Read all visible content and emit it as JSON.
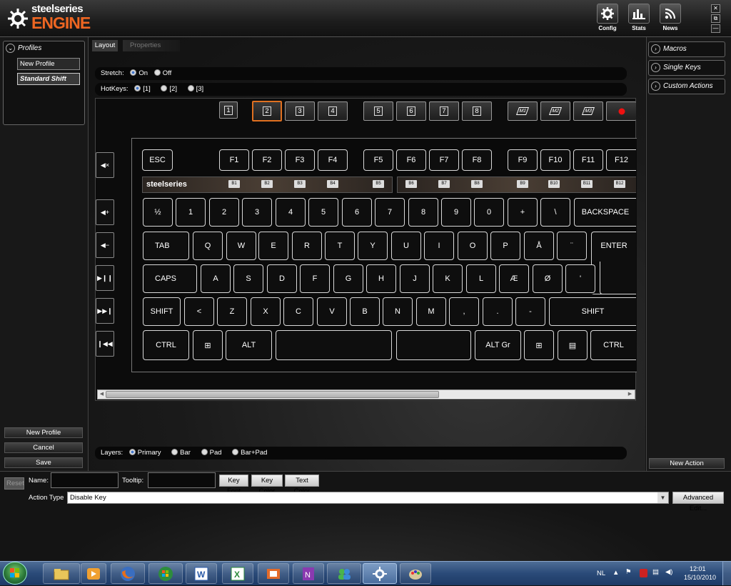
{
  "app": {
    "brand_top": "steelseries",
    "brand_bottom": "ENGINE"
  },
  "topbar": {
    "config": "Config",
    "stats": "Stats",
    "news": "News",
    "close_glyph": "✕",
    "restore_glyph": "⧉",
    "minimize_glyph": "—"
  },
  "tabs": {
    "layout": "Layout",
    "properties": "Properties"
  },
  "profiles": {
    "header": "Profiles",
    "items": [
      "New Profile",
      "Standard Shift"
    ],
    "new_btn": "New Profile",
    "cancel_btn": "Cancel",
    "save_btn": "Save"
  },
  "options": {
    "stretch_label": "Stretch:",
    "stretch_on": "On",
    "stretch_off": "Off",
    "stretch_selected": "On",
    "hotkeys_label": "HotKeys:",
    "hotkeys_opts": [
      "[1]",
      "[2]",
      "[3]"
    ],
    "hotkeys_selected": "[1]"
  },
  "hotkey_buttons": [
    "1",
    "2",
    "3",
    "4",
    "5",
    "6",
    "7",
    "8"
  ],
  "macro_buttons": [
    "M1",
    "M2",
    "M3"
  ],
  "keyboard": {
    "brand": "steelseries",
    "fn_row": [
      "ESC",
      "F1",
      "F2",
      "F3",
      "F4",
      "F5",
      "F6",
      "F7",
      "F8",
      "F9",
      "F10",
      "F11",
      "F12"
    ],
    "lamp_labels": [
      "B1",
      "B2",
      "B3",
      "B4",
      "B5",
      "B6",
      "B7",
      "B8",
      "B9",
      "B10",
      "B11",
      "B12"
    ],
    "num_row": [
      "½",
      "1",
      "2",
      "3",
      "4",
      "5",
      "6",
      "7",
      "8",
      "9",
      "0",
      "+",
      "\\",
      "BACKSPACE"
    ],
    "tab_row": [
      "TAB",
      "Q",
      "W",
      "E",
      "R",
      "T",
      "Y",
      "U",
      "I",
      "O",
      "P",
      "Å",
      "¨",
      "ENTER"
    ],
    "caps_row": [
      "CAPS",
      "A",
      "S",
      "D",
      "F",
      "G",
      "H",
      "J",
      "K",
      "L",
      "Æ",
      "Ø",
      "'"
    ],
    "shift_row": [
      "SHIFT",
      "<",
      "Z",
      "X",
      "C",
      "V",
      "B",
      "N",
      "M",
      ",",
      ".",
      "-",
      "SHIFT"
    ],
    "ctrl_row": [
      "CTRL",
      "⊞",
      "ALT",
      "",
      "",
      "ALT Gr",
      "⊞",
      "▤",
      "CTRL"
    ],
    "side_keys": [
      "◀×",
      "◀+",
      "◀−",
      "▶❙❙",
      "▶▶❙",
      "❙◀◀"
    ]
  },
  "layers": {
    "label": "Layers:",
    "options": [
      "Primary",
      "Bar",
      "Pad",
      "Bar+Pad"
    ],
    "selected": "Primary"
  },
  "right_panel": {
    "items": [
      "Macros",
      "Single Keys",
      "Custom Actions"
    ],
    "new_action": "New Action"
  },
  "editor": {
    "reset": "Reset",
    "name_label": "Name:",
    "name_value": "",
    "tooltip_label": "Tooltip:",
    "tooltip_value": "",
    "key_font": "Key Font",
    "key_color": "Key Color",
    "text_color": "Text Color",
    "action_type_label": "Action Type",
    "action_type_value": "Disable Key",
    "advanced_edit": "Advanced Edit..."
  },
  "taskbar": {
    "language": "NL",
    "time": "12:01",
    "date": "15/10/2010"
  },
  "colors": {
    "accent": "#ee6622",
    "selected_key_border": "#e07020"
  }
}
